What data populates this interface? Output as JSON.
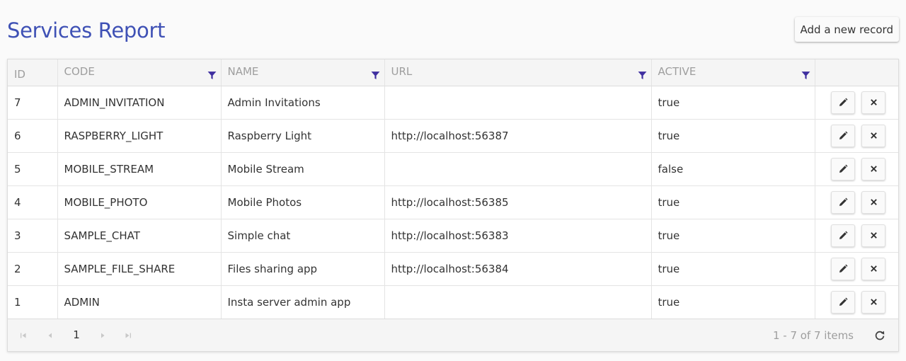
{
  "title": "Services Report",
  "add_button_label": "Add a new record",
  "columns": [
    {
      "label": "ID",
      "filterable": false
    },
    {
      "label": "CODE",
      "filterable": true
    },
    {
      "label": "NAME",
      "filterable": true
    },
    {
      "label": "URL",
      "filterable": true
    },
    {
      "label": "ACTIVE",
      "filterable": true
    },
    {
      "label": "",
      "filterable": false
    }
  ],
  "rows": [
    {
      "id": "7",
      "code": "ADMIN_INVITATION",
      "name": "Admin Invitations",
      "url": "",
      "active": "true"
    },
    {
      "id": "6",
      "code": "RASPBERRY_LIGHT",
      "name": "Raspberry Light",
      "url": "http://localhost:56387",
      "active": "true"
    },
    {
      "id": "5",
      "code": "MOBILE_STREAM",
      "name": "Mobile Stream",
      "url": "",
      "active": "false"
    },
    {
      "id": "4",
      "code": "MOBILE_PHOTO",
      "name": "Mobile Photos",
      "url": "http://localhost:56385",
      "active": "true"
    },
    {
      "id": "3",
      "code": "SAMPLE_CHAT",
      "name": "Simple chat",
      "url": "http://localhost:56383",
      "active": "true"
    },
    {
      "id": "2",
      "code": "SAMPLE_FILE_SHARE",
      "name": "Files sharing app",
      "url": "http://localhost:56384",
      "active": "true"
    },
    {
      "id": "1",
      "code": "ADMIN",
      "name": "Insta server admin app",
      "url": "",
      "active": "true"
    }
  ],
  "row_actions": {
    "edit_icon": "pencil-icon",
    "delete_icon": "close-icon"
  },
  "pager": {
    "current_page": "1",
    "info": "1 - 7 of 7 items",
    "icons": [
      "first-page-icon",
      "prev-page-icon",
      "next-page-icon",
      "last-page-icon",
      "refresh-icon"
    ]
  },
  "colors": {
    "title": "#3f51b5",
    "filter_icon": "#3f2fa0",
    "header_text": "#9e9e9e",
    "body_text": "#333333"
  }
}
